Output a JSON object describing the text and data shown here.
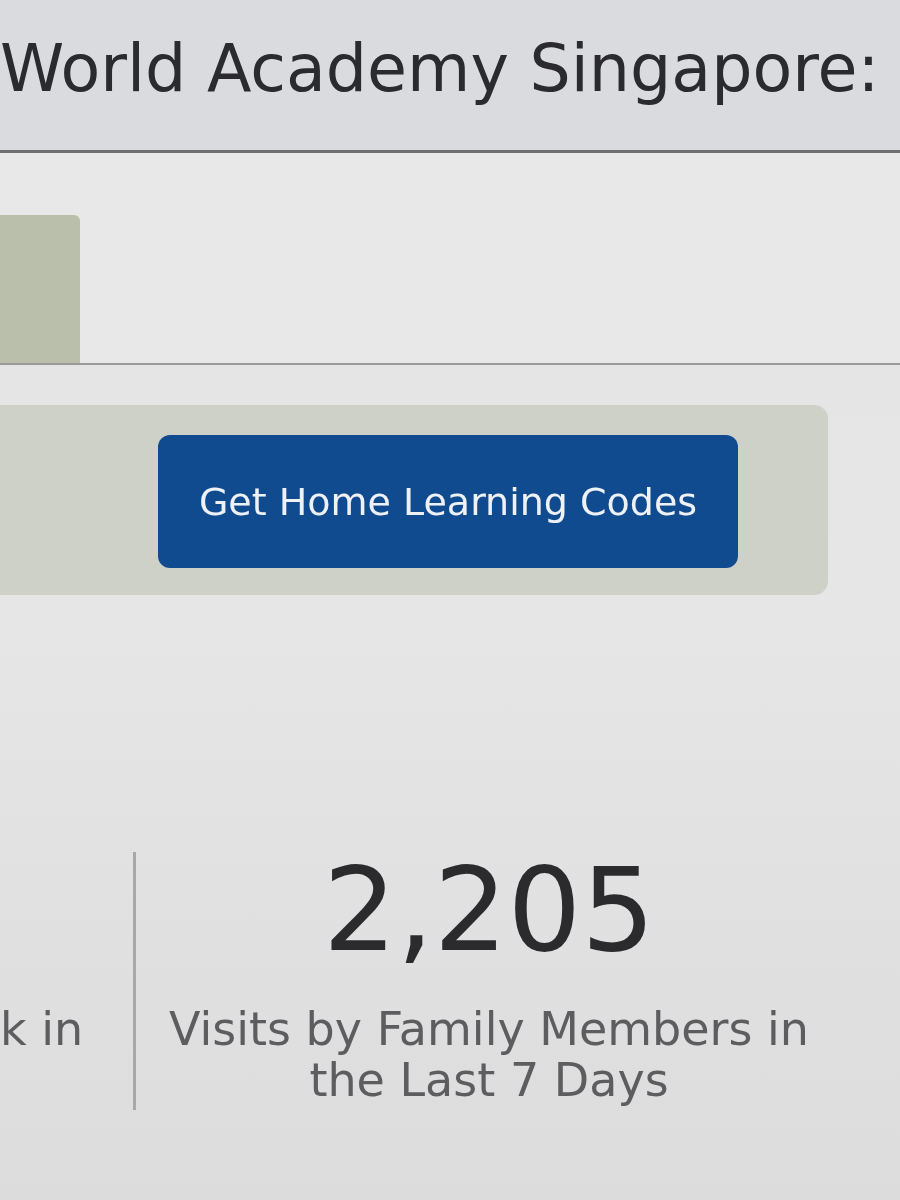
{
  "header": {
    "title": "World Academy Singapore:"
  },
  "action_panel": {
    "button": "Get Home Learning Codes"
  },
  "stats": [
    {
      "label": "k in"
    },
    {
      "value": "2,205",
      "label": "Visits by Family Members in the Last 7 Days"
    }
  ]
}
